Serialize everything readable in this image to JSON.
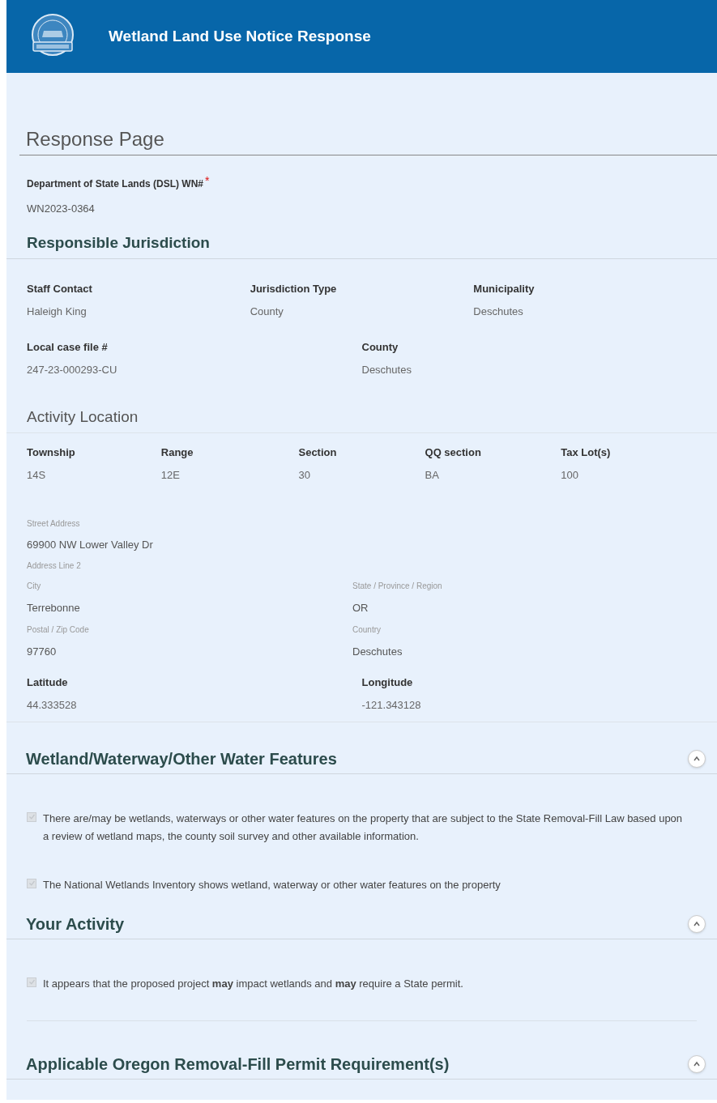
{
  "header": {
    "title": "Wetland Land Use Notice Response"
  },
  "page_title": "Response Page",
  "wn_field": {
    "label": "Department of State Lands (DSL) WN#",
    "required": true,
    "required_mark": "*",
    "value": "WN2023-0364"
  },
  "jurisdiction": {
    "title": "Responsible Jurisdiction",
    "rows": [
      [
        {
          "label": "Staff Contact",
          "value": "Haleigh King"
        },
        {
          "label": "Jurisdiction Type",
          "value": "County"
        },
        {
          "label": "Municipality",
          "value": "Deschutes"
        }
      ],
      [
        {
          "label": "Local case file #",
          "value": "247-23-000293-CU"
        },
        {
          "label": "County",
          "value": "Deschutes"
        }
      ]
    ]
  },
  "activity_location": {
    "title": "Activity Location",
    "plss": [
      {
        "label": "Township",
        "value": "14S"
      },
      {
        "label": "Range",
        "value": "12E"
      },
      {
        "label": "Section",
        "value": "30"
      },
      {
        "label": "QQ section",
        "value": "BA"
      },
      {
        "label": "Tax Lot(s)",
        "value": "100"
      }
    ],
    "address": {
      "street_label": "Street Address",
      "street": "69900 NW Lower Valley Dr",
      "line2_label": "Address Line 2",
      "fields": [
        {
          "label": "City",
          "value": "Terrebonne"
        },
        {
          "label": "State / Province / Region",
          "value": "OR"
        },
        {
          "label": "Postal / Zip Code",
          "value": "97760"
        },
        {
          "label": "Country",
          "value": "Deschutes"
        }
      ]
    },
    "coords": [
      {
        "label": "Latitude",
        "value": "44.333528"
      },
      {
        "label": "Longitude",
        "value": "-121.343128"
      }
    ]
  },
  "sections": [
    {
      "title": "Wetland/Waterway/Other Water Features",
      "expanded": true,
      "items": [
        {
          "text": "There are/may be wetlands, waterways or other water features on the property that are subject to the State Removal-Fill Law based upon a review of wetland maps, the county soil survey and other available information.",
          "checked": true,
          "disabled": true
        },
        {
          "text": "The National Wetlands Inventory shows wetland, waterway or other water features on the property",
          "checked": true,
          "disabled": true
        }
      ]
    },
    {
      "title": "Your Activity",
      "expanded": true,
      "items": [
        {
          "text": "It appears that the proposed project **may** impact wetlands and **may** require a State permit.",
          "checked": true,
          "disabled": true
        }
      ]
    },
    {
      "title": "Applicable Oregon Removal-Fill Permit Requirement(s)",
      "expanded": true
    }
  ]
}
